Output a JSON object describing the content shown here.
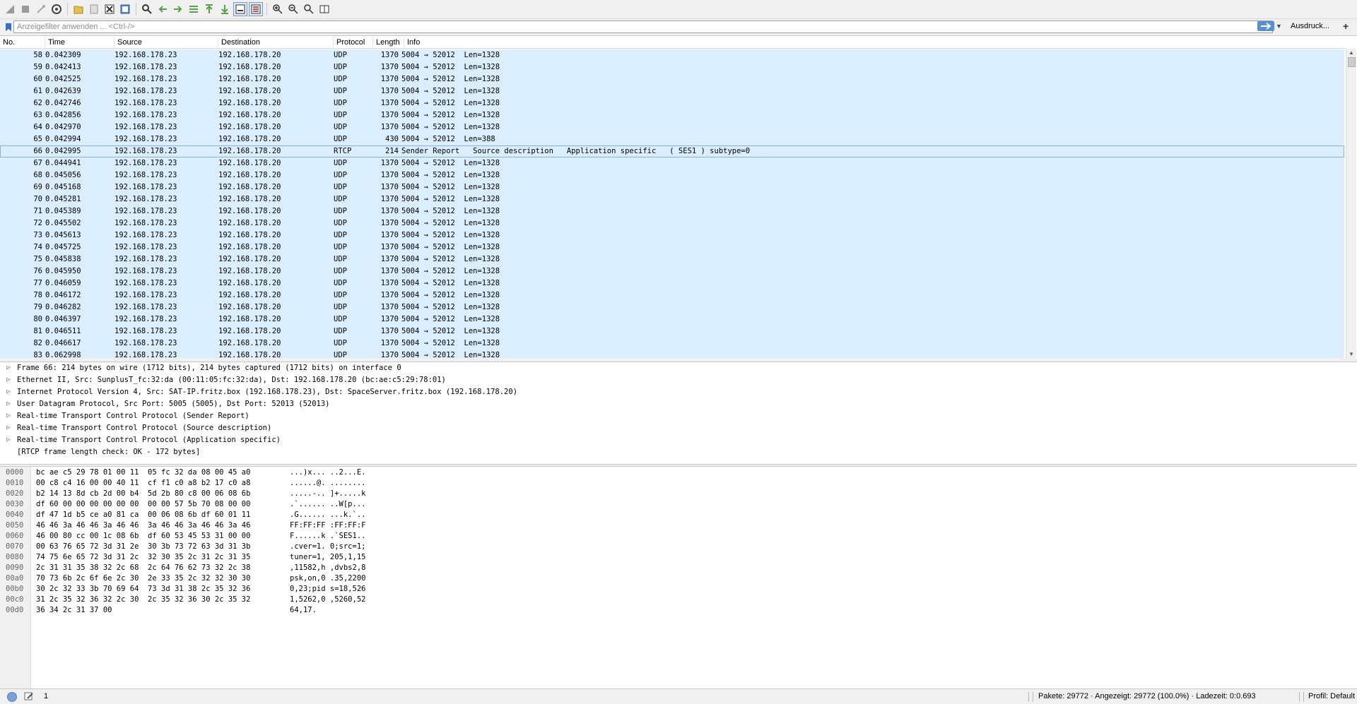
{
  "toolbar": {
    "icons": [
      "start-capture-icon",
      "stop-capture-icon",
      "restart-capture-icon",
      "capture-options-icon",
      "open-file-icon",
      "save-file-icon",
      "close-file-icon",
      "reload-file-icon",
      "find-packet-icon",
      "go-back-icon",
      "go-forward-icon",
      "go-to-packet-icon",
      "first-packet-icon",
      "last-packet-icon",
      "auto-scroll-icon",
      "colorize-icon",
      "zoom-in-icon",
      "zoom-out-icon",
      "normal-size-icon",
      "resize-columns-icon"
    ]
  },
  "filter": {
    "placeholder": "Anzeigefilter anwenden ... <Ctrl-/>",
    "expression_label": "Ausdruck..."
  },
  "packet_list": {
    "columns": [
      "No.",
      "Time",
      "Source",
      "Destination",
      "Protocol",
      "Length",
      "Info"
    ],
    "rows": [
      {
        "no": "58",
        "time": "0.042309",
        "src": "192.168.178.23",
        "dst": "192.168.178.20",
        "proto": "UDP",
        "len": "1370",
        "info": "5004 → 52012  Len=1328"
      },
      {
        "no": "59",
        "time": "0.042413",
        "src": "192.168.178.23",
        "dst": "192.168.178.20",
        "proto": "UDP",
        "len": "1370",
        "info": "5004 → 52012  Len=1328"
      },
      {
        "no": "60",
        "time": "0.042525",
        "src": "192.168.178.23",
        "dst": "192.168.178.20",
        "proto": "UDP",
        "len": "1370",
        "info": "5004 → 52012  Len=1328"
      },
      {
        "no": "61",
        "time": "0.042639",
        "src": "192.168.178.23",
        "dst": "192.168.178.20",
        "proto": "UDP",
        "len": "1370",
        "info": "5004 → 52012  Len=1328"
      },
      {
        "no": "62",
        "time": "0.042746",
        "src": "192.168.178.23",
        "dst": "192.168.178.20",
        "proto": "UDP",
        "len": "1370",
        "info": "5004 → 52012  Len=1328"
      },
      {
        "no": "63",
        "time": "0.042856",
        "src": "192.168.178.23",
        "dst": "192.168.178.20",
        "proto": "UDP",
        "len": "1370",
        "info": "5004 → 52012  Len=1328"
      },
      {
        "no": "64",
        "time": "0.042970",
        "src": "192.168.178.23",
        "dst": "192.168.178.20",
        "proto": "UDP",
        "len": "1370",
        "info": "5004 → 52012  Len=1328"
      },
      {
        "no": "65",
        "time": "0.042994",
        "src": "192.168.178.23",
        "dst": "192.168.178.20",
        "proto": "UDP",
        "len": "430",
        "info": "5004 → 52012  Len=388"
      },
      {
        "no": "66",
        "time": "0.042995",
        "src": "192.168.178.23",
        "dst": "192.168.178.20",
        "proto": "RTCP",
        "len": "214",
        "info": "Sender Report   Source description   Application specific   ( SES1 ) subtype=0",
        "selected": true
      },
      {
        "no": "67",
        "time": "0.044941",
        "src": "192.168.178.23",
        "dst": "192.168.178.20",
        "proto": "UDP",
        "len": "1370",
        "info": "5004 → 52012  Len=1328"
      },
      {
        "no": "68",
        "time": "0.045056",
        "src": "192.168.178.23",
        "dst": "192.168.178.20",
        "proto": "UDP",
        "len": "1370",
        "info": "5004 → 52012  Len=1328"
      },
      {
        "no": "69",
        "time": "0.045168",
        "src": "192.168.178.23",
        "dst": "192.168.178.20",
        "proto": "UDP",
        "len": "1370",
        "info": "5004 → 52012  Len=1328"
      },
      {
        "no": "70",
        "time": "0.045281",
        "src": "192.168.178.23",
        "dst": "192.168.178.20",
        "proto": "UDP",
        "len": "1370",
        "info": "5004 → 52012  Len=1328"
      },
      {
        "no": "71",
        "time": "0.045389",
        "src": "192.168.178.23",
        "dst": "192.168.178.20",
        "proto": "UDP",
        "len": "1370",
        "info": "5004 → 52012  Len=1328"
      },
      {
        "no": "72",
        "time": "0.045502",
        "src": "192.168.178.23",
        "dst": "192.168.178.20",
        "proto": "UDP",
        "len": "1370",
        "info": "5004 → 52012  Len=1328"
      },
      {
        "no": "73",
        "time": "0.045613",
        "src": "192.168.178.23",
        "dst": "192.168.178.20",
        "proto": "UDP",
        "len": "1370",
        "info": "5004 → 52012  Len=1328"
      },
      {
        "no": "74",
        "time": "0.045725",
        "src": "192.168.178.23",
        "dst": "192.168.178.20",
        "proto": "UDP",
        "len": "1370",
        "info": "5004 → 52012  Len=1328"
      },
      {
        "no": "75",
        "time": "0.045838",
        "src": "192.168.178.23",
        "dst": "192.168.178.20",
        "proto": "UDP",
        "len": "1370",
        "info": "5004 → 52012  Len=1328"
      },
      {
        "no": "76",
        "time": "0.045950",
        "src": "192.168.178.23",
        "dst": "192.168.178.20",
        "proto": "UDP",
        "len": "1370",
        "info": "5004 → 52012  Len=1328"
      },
      {
        "no": "77",
        "time": "0.046059",
        "src": "192.168.178.23",
        "dst": "192.168.178.20",
        "proto": "UDP",
        "len": "1370",
        "info": "5004 → 52012  Len=1328"
      },
      {
        "no": "78",
        "time": "0.046172",
        "src": "192.168.178.23",
        "dst": "192.168.178.20",
        "proto": "UDP",
        "len": "1370",
        "info": "5004 → 52012  Len=1328"
      },
      {
        "no": "79",
        "time": "0.046282",
        "src": "192.168.178.23",
        "dst": "192.168.178.20",
        "proto": "UDP",
        "len": "1370",
        "info": "5004 → 52012  Len=1328"
      },
      {
        "no": "80",
        "time": "0.046397",
        "src": "192.168.178.23",
        "dst": "192.168.178.20",
        "proto": "UDP",
        "len": "1370",
        "info": "5004 → 52012  Len=1328"
      },
      {
        "no": "81",
        "time": "0.046511",
        "src": "192.168.178.23",
        "dst": "192.168.178.20",
        "proto": "UDP",
        "len": "1370",
        "info": "5004 → 52012  Len=1328"
      },
      {
        "no": "82",
        "time": "0.046617",
        "src": "192.168.178.23",
        "dst": "192.168.178.20",
        "proto": "UDP",
        "len": "1370",
        "info": "5004 → 52012  Len=1328"
      },
      {
        "no": "83",
        "time": "0.062998",
        "src": "192.168.178.23",
        "dst": "192.168.178.20",
        "proto": "UDP",
        "len": "1370",
        "info": "5004 → 52012  Len=1328"
      }
    ]
  },
  "details": [
    {
      "text": "Frame 66: 214 bytes on wire (1712 bits), 214 bytes captured (1712 bits) on interface 0",
      "expandable": true
    },
    {
      "text": "Ethernet II, Src: SunplusT_fc:32:da (00:11:05:fc:32:da), Dst: 192.168.178.20 (bc:ae:c5:29:78:01)",
      "expandable": true
    },
    {
      "text": "Internet Protocol Version 4, Src: SAT-IP.fritz.box (192.168.178.23), Dst: SpaceServer.fritz.box (192.168.178.20)",
      "expandable": true
    },
    {
      "text": "User Datagram Protocol, Src Port: 5005 (5005), Dst Port: 52013 (52013)",
      "expandable": true
    },
    {
      "text": "Real-time Transport Control Protocol (Sender Report)",
      "expandable": true
    },
    {
      "text": "Real-time Transport Control Protocol (Source description)",
      "expandable": true
    },
    {
      "text": "Real-time Transport Control Protocol (Application specific)",
      "expandable": true
    },
    {
      "text": "[RTCP frame length check: OK - 172 bytes]",
      "expandable": false
    }
  ],
  "bytes": {
    "offsets": [
      "0000",
      "0010",
      "0020",
      "0030",
      "0040",
      "0050",
      "0060",
      "0070",
      "0080",
      "0090",
      "00a0",
      "00b0",
      "00c0",
      "00d0"
    ],
    "hex": [
      "bc ae c5 29 78 01 00 11  05 fc 32 da 08 00 45 a0",
      "00 c8 c4 16 00 00 40 11  cf f1 c0 a8 b2 17 c0 a8",
      "b2 14 13 8d cb 2d 00 b4  5d 2b 80 c8 00 06 08 6b",
      "df 60 00 00 00 00 00 00  00 00 57 5b 70 08 00 00",
      "df 47 1d b5 ce a0 81 ca  00 06 08 6b df 60 01 11",
      "46 46 3a 46 46 3a 46 46  3a 46 46 3a 46 46 3a 46",
      "46 00 80 cc 00 1c 08 6b  df 60 53 45 53 31 00 00",
      "00 63 76 65 72 3d 31 2e  30 3b 73 72 63 3d 31 3b",
      "74 75 6e 65 72 3d 31 2c  32 30 35 2c 31 2c 31 35",
      "2c 31 31 35 38 32 2c 68  2c 64 76 62 73 32 2c 38",
      "70 73 6b 2c 6f 6e 2c 30  2e 33 35 2c 32 32 30 30",
      "30 2c 32 33 3b 70 69 64  73 3d 31 38 2c 35 32 36",
      "31 2c 35 32 36 32 2c 30  2c 35 32 36 30 2c 35 32",
      "36 34 2c 31 37 00"
    ],
    "ascii": [
      "...)x... ..2...E.",
      "......@. ........",
      ".....-.. ]+.....k",
      ".`...... ..W[p...",
      ".G...... ...k.`..",
      "FF:FF:FF :FF:FF:F",
      "F......k .`SES1..",
      ".cver=1. 0;src=1;",
      "tuner=1, 205,1,15",
      ",11582,h ,dvbs2,8",
      "psk,on,0 .35,2200",
      "0,23;pid s=18,526",
      "1,5262,0 ,5260,52",
      "64,17."
    ]
  },
  "status": {
    "left_text": "1",
    "packets": "Pakete: 29772 · Angezeigt: 29772 (100.0%) · Ladezeit: 0:0.693",
    "profile": "Profil: Default"
  }
}
